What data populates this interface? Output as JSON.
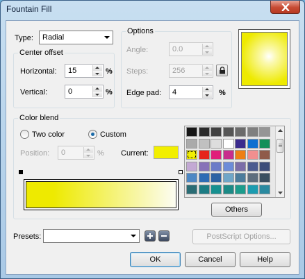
{
  "window": {
    "title": "Fountain Fill"
  },
  "type": {
    "label": "Type:",
    "value": "Radial"
  },
  "center_offset": {
    "title": "Center offset",
    "horizontal_label": "Horizontal:",
    "horizontal_value": "15",
    "vertical_label": "Vertical:",
    "vertical_value": "0",
    "unit": "%"
  },
  "options": {
    "title": "Options",
    "angle_label": "Angle:",
    "angle_value": "0.0",
    "steps_label": "Steps:",
    "steps_value": "256",
    "edge_pad_label": "Edge pad:",
    "edge_pad_value": "4",
    "unit": "%"
  },
  "color_blend": {
    "title": "Color blend",
    "two_color_label": "Two color",
    "custom_label": "Custom",
    "selected_mode": "Custom",
    "position_label": "Position:",
    "position_value": "0",
    "position_unit": "%",
    "current_label": "Current:",
    "current_color": "#f2ef00",
    "gradient_from": "#eeea00",
    "gradient_to": "#fcfcf2"
  },
  "palette": {
    "colors": [
      "#161616",
      "#2b2b2b",
      "#404040",
      "#555555",
      "#6b6b6b",
      "#808080",
      "#959595",
      "#aaaaaa",
      "#c0c0c0",
      "#dddddd",
      "#ffffff",
      "#3b2b8e",
      "#0d6fd1",
      "#13905a",
      "#f2ef00",
      "#e5251c",
      "#e01f7a",
      "#c82c8c",
      "#ee7f14",
      "#f18f8f",
      "#8f5a4a",
      "#c3a9d4",
      "#8772b8",
      "#6b7bc8",
      "#6c8cd8",
      "#7c6ea8",
      "#4c5c90",
      "#3c4c7a",
      "#4e88c4",
      "#2e6cb4",
      "#2c62a4",
      "#6fa6c8",
      "#4c7c9c",
      "#5e6e7e",
      "#3a5060",
      "#2a6c74",
      "#1c7c84",
      "#169090",
      "#1c8a86",
      "#1c9c8c",
      "#1c9cb0",
      "#2a8aa0"
    ],
    "others_label": "Others"
  },
  "presets": {
    "label": "Presets:",
    "value": ""
  },
  "buttons": {
    "postscript_label": "PostScript Options...",
    "ok_label": "OK",
    "cancel_label": "Cancel",
    "help_label": "Help"
  }
}
